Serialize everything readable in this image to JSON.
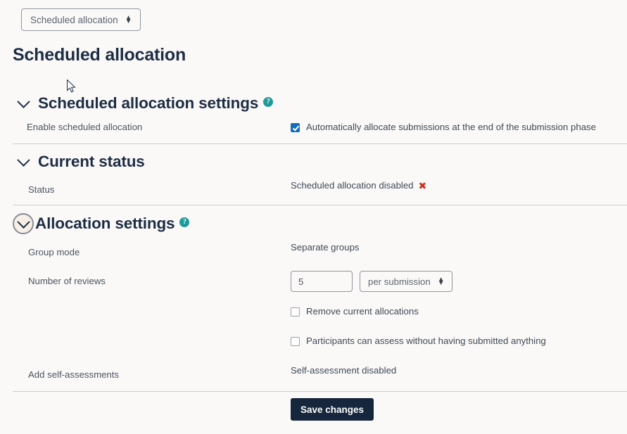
{
  "jump_menu": {
    "selected": "Scheduled allocation",
    "icon": "updown-arrows-icon"
  },
  "page_title": "Scheduled allocation",
  "sections": [
    {
      "id": "scheduled-allocation-settings",
      "title": "Scheduled allocation settings",
      "has_help": true,
      "help_glyph": "?",
      "expanded": true,
      "focused": false,
      "rows": [
        {
          "label": "Enable scheduled allocation",
          "control": "checkbox",
          "checkbox_label": "Automatically allocate submissions at the end of the submission phase",
          "checked": true
        }
      ]
    },
    {
      "id": "current-status",
      "title": "Current status",
      "has_help": false,
      "expanded": true,
      "focused": false,
      "rows": [
        {
          "label": "Status",
          "control": "text",
          "value": "Scheduled allocation disabled",
          "status_mark": "✖"
        }
      ]
    },
    {
      "id": "allocation-settings",
      "title": "Allocation settings",
      "has_help": true,
      "help_glyph": "?",
      "expanded": true,
      "focused": true,
      "rows": [
        {
          "label": "Group mode",
          "control": "text",
          "value": "Separate groups"
        },
        {
          "label": "Number of reviews",
          "control": "number-and-select",
          "number_value": "5",
          "select_value": "per submission"
        },
        {
          "label": "",
          "control": "checkbox",
          "checkbox_label": "Remove current allocations",
          "checked": false
        },
        {
          "label": "",
          "control": "checkbox",
          "checkbox_label": "Participants can assess without having submitted anything",
          "checked": false
        },
        {
          "label": "Add self-assessments",
          "control": "text",
          "value": "Self-assessment disabled"
        }
      ]
    }
  ],
  "actions": {
    "save_label": "Save changes"
  },
  "colors": {
    "page_background": "#fbf9f8",
    "heading": "#1d2d44",
    "help_badge": "#1f9a9a",
    "checkbox_checked": "#0f6cbf",
    "status_error": "#ca3120",
    "primary_button": "#16263c",
    "separator": "#c9ccd4",
    "focus_ring": "#868d96",
    "focus_fill": "#f6efe6"
  }
}
